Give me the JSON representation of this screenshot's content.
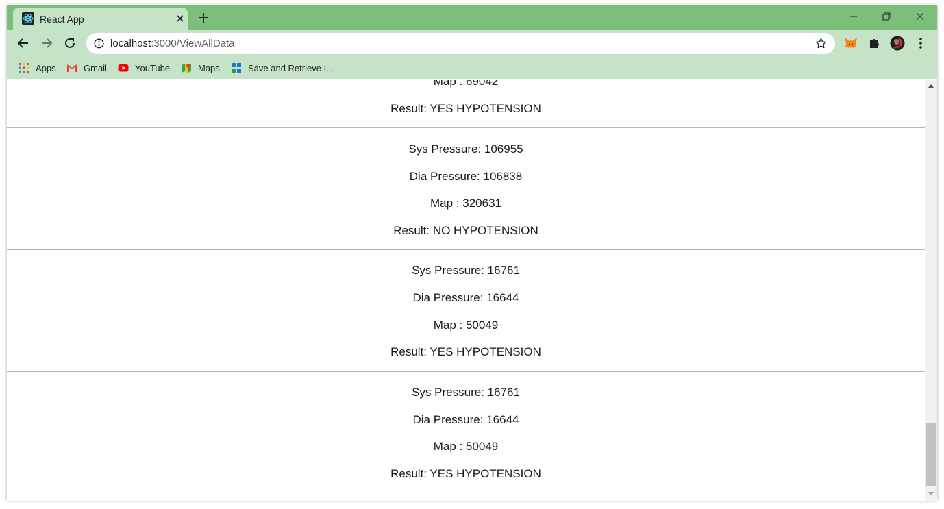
{
  "browser": {
    "tab_title": "React App",
    "url_host": "localhost",
    "url_path": ":3000/ViewAllData",
    "bookmarks": [
      {
        "label": "Apps",
        "icon": "apps-grid-icon"
      },
      {
        "label": "Gmail",
        "icon": "gmail-icon"
      },
      {
        "label": "YouTube",
        "icon": "youtube-icon"
      },
      {
        "label": "Maps",
        "icon": "maps-icon"
      },
      {
        "label": "Save and Retrieve I...",
        "icon": "bookmark-site-icon"
      }
    ],
    "theme_color": "#7bbf7b",
    "toolbar_color": "#c5e3c7"
  },
  "records": [
    {
      "map_line": "Map : 69042",
      "result_line": "Result: YES HYPOTENSION"
    },
    {
      "sys_line": "Sys Pressure: 106955",
      "dia_line": "Dia Pressure: 106838",
      "map_line": "Map : 320631",
      "result_line": "Result: NO HYPOTENSION"
    },
    {
      "sys_line": "Sys Pressure: 16761",
      "dia_line": "Dia Pressure: 16644",
      "map_line": "Map : 50049",
      "result_line": "Result: YES HYPOTENSION"
    },
    {
      "sys_line": "Sys Pressure: 16761",
      "dia_line": "Dia Pressure: 16644",
      "map_line": "Map : 50049",
      "result_line": "Result: YES HYPOTENSION"
    }
  ]
}
